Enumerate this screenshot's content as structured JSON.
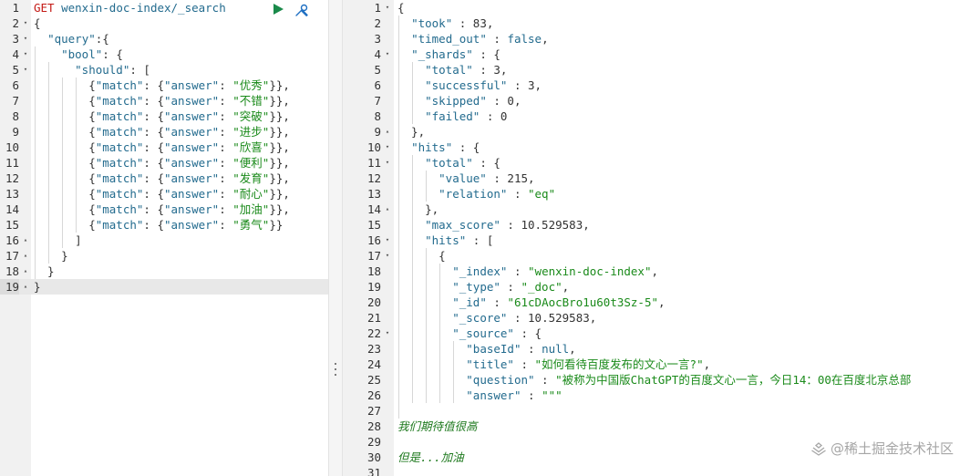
{
  "request_editor": {
    "lines": [
      {
        "n": "1",
        "fold": "",
        "tokens": [
          {
            "t": "GET",
            "c": "method"
          },
          {
            "t": " ",
            "c": "punc"
          },
          {
            "t": "wenxin-doc-index/_search",
            "c": "url"
          }
        ]
      },
      {
        "n": "2",
        "fold": "▾",
        "tokens": [
          {
            "t": "{",
            "c": "punc"
          }
        ]
      },
      {
        "n": "3",
        "fold": "▾",
        "tokens": [
          {
            "t": "  ",
            "c": "punc"
          },
          {
            "t": "\"query\"",
            "c": "key"
          },
          {
            "t": ":{",
            "c": "punc"
          }
        ]
      },
      {
        "n": "4",
        "fold": "▾",
        "tokens": [
          {
            "t": "    ",
            "c": "punc"
          },
          {
            "t": "\"bool\"",
            "c": "key"
          },
          {
            "t": ": {",
            "c": "punc"
          }
        ]
      },
      {
        "n": "5",
        "fold": "▾",
        "tokens": [
          {
            "t": "      ",
            "c": "punc"
          },
          {
            "t": "\"should\"",
            "c": "key"
          },
          {
            "t": ": [",
            "c": "punc"
          }
        ]
      },
      {
        "n": "6",
        "fold": "",
        "tokens": [
          {
            "t": "        {",
            "c": "punc"
          },
          {
            "t": "\"match\"",
            "c": "key"
          },
          {
            "t": ": {",
            "c": "punc"
          },
          {
            "t": "\"answer\"",
            "c": "key"
          },
          {
            "t": ": ",
            "c": "punc"
          },
          {
            "t": "\"优秀\"",
            "c": "str"
          },
          {
            "t": "}},",
            "c": "punc"
          }
        ]
      },
      {
        "n": "7",
        "fold": "",
        "tokens": [
          {
            "t": "        {",
            "c": "punc"
          },
          {
            "t": "\"match\"",
            "c": "key"
          },
          {
            "t": ": {",
            "c": "punc"
          },
          {
            "t": "\"answer\"",
            "c": "key"
          },
          {
            "t": ": ",
            "c": "punc"
          },
          {
            "t": "\"不错\"",
            "c": "str"
          },
          {
            "t": "}},",
            "c": "punc"
          }
        ]
      },
      {
        "n": "8",
        "fold": "",
        "tokens": [
          {
            "t": "        {",
            "c": "punc"
          },
          {
            "t": "\"match\"",
            "c": "key"
          },
          {
            "t": ": {",
            "c": "punc"
          },
          {
            "t": "\"answer\"",
            "c": "key"
          },
          {
            "t": ": ",
            "c": "punc"
          },
          {
            "t": "\"突破\"",
            "c": "str"
          },
          {
            "t": "}},",
            "c": "punc"
          }
        ]
      },
      {
        "n": "9",
        "fold": "",
        "tokens": [
          {
            "t": "        {",
            "c": "punc"
          },
          {
            "t": "\"match\"",
            "c": "key"
          },
          {
            "t": ": {",
            "c": "punc"
          },
          {
            "t": "\"answer\"",
            "c": "key"
          },
          {
            "t": ": ",
            "c": "punc"
          },
          {
            "t": "\"进步\"",
            "c": "str"
          },
          {
            "t": "}},",
            "c": "punc"
          }
        ]
      },
      {
        "n": "10",
        "fold": "",
        "tokens": [
          {
            "t": "        {",
            "c": "punc"
          },
          {
            "t": "\"match\"",
            "c": "key"
          },
          {
            "t": ": {",
            "c": "punc"
          },
          {
            "t": "\"answer\"",
            "c": "key"
          },
          {
            "t": ": ",
            "c": "punc"
          },
          {
            "t": "\"欣喜\"",
            "c": "str"
          },
          {
            "t": "}},",
            "c": "punc"
          }
        ]
      },
      {
        "n": "11",
        "fold": "",
        "tokens": [
          {
            "t": "        {",
            "c": "punc"
          },
          {
            "t": "\"match\"",
            "c": "key"
          },
          {
            "t": ": {",
            "c": "punc"
          },
          {
            "t": "\"answer\"",
            "c": "key"
          },
          {
            "t": ": ",
            "c": "punc"
          },
          {
            "t": "\"便利\"",
            "c": "str"
          },
          {
            "t": "}},",
            "c": "punc"
          }
        ]
      },
      {
        "n": "12",
        "fold": "",
        "tokens": [
          {
            "t": "        {",
            "c": "punc"
          },
          {
            "t": "\"match\"",
            "c": "key"
          },
          {
            "t": ": {",
            "c": "punc"
          },
          {
            "t": "\"answer\"",
            "c": "key"
          },
          {
            "t": ": ",
            "c": "punc"
          },
          {
            "t": "\"发育\"",
            "c": "str"
          },
          {
            "t": "}},",
            "c": "punc"
          }
        ]
      },
      {
        "n": "13",
        "fold": "",
        "tokens": [
          {
            "t": "        {",
            "c": "punc"
          },
          {
            "t": "\"match\"",
            "c": "key"
          },
          {
            "t": ": {",
            "c": "punc"
          },
          {
            "t": "\"answer\"",
            "c": "key"
          },
          {
            "t": ": ",
            "c": "punc"
          },
          {
            "t": "\"耐心\"",
            "c": "str"
          },
          {
            "t": "}},",
            "c": "punc"
          }
        ]
      },
      {
        "n": "14",
        "fold": "",
        "tokens": [
          {
            "t": "        {",
            "c": "punc"
          },
          {
            "t": "\"match\"",
            "c": "key"
          },
          {
            "t": ": {",
            "c": "punc"
          },
          {
            "t": "\"answer\"",
            "c": "key"
          },
          {
            "t": ": ",
            "c": "punc"
          },
          {
            "t": "\"加油\"",
            "c": "str"
          },
          {
            "t": "}},",
            "c": "punc"
          }
        ]
      },
      {
        "n": "15",
        "fold": "",
        "tokens": [
          {
            "t": "        {",
            "c": "punc"
          },
          {
            "t": "\"match\"",
            "c": "key"
          },
          {
            "t": ": {",
            "c": "punc"
          },
          {
            "t": "\"answer\"",
            "c": "key"
          },
          {
            "t": ": ",
            "c": "punc"
          },
          {
            "t": "\"勇气\"",
            "c": "str"
          },
          {
            "t": "}}",
            "c": "punc"
          }
        ]
      },
      {
        "n": "16",
        "fold": "▴",
        "tokens": [
          {
            "t": "      ]",
            "c": "punc"
          }
        ]
      },
      {
        "n": "17",
        "fold": "▴",
        "tokens": [
          {
            "t": "    }",
            "c": "punc"
          }
        ]
      },
      {
        "n": "18",
        "fold": "▴",
        "tokens": [
          {
            "t": "  }",
            "c": "punc"
          }
        ]
      },
      {
        "n": "19",
        "fold": "▴",
        "tokens": [
          {
            "t": "}",
            "c": "punc"
          }
        ],
        "active": true
      }
    ]
  },
  "response_viewer": {
    "lines": [
      {
        "n": "1",
        "fold": "▾",
        "tokens": [
          {
            "t": "{",
            "c": "punc"
          }
        ]
      },
      {
        "n": "2",
        "fold": "",
        "tokens": [
          {
            "t": "  ",
            "c": "punc"
          },
          {
            "t": "\"took\"",
            "c": "key"
          },
          {
            "t": " : ",
            "c": "punc"
          },
          {
            "t": "83",
            "c": "num"
          },
          {
            "t": ",",
            "c": "punc"
          }
        ]
      },
      {
        "n": "3",
        "fold": "",
        "tokens": [
          {
            "t": "  ",
            "c": "punc"
          },
          {
            "t": "\"timed_out\"",
            "c": "key"
          },
          {
            "t": " : ",
            "c": "punc"
          },
          {
            "t": "false",
            "c": "lit"
          },
          {
            "t": ",",
            "c": "punc"
          }
        ]
      },
      {
        "n": "4",
        "fold": "▾",
        "tokens": [
          {
            "t": "  ",
            "c": "punc"
          },
          {
            "t": "\"_shards\"",
            "c": "key"
          },
          {
            "t": " : {",
            "c": "punc"
          }
        ]
      },
      {
        "n": "5",
        "fold": "",
        "tokens": [
          {
            "t": "    ",
            "c": "punc"
          },
          {
            "t": "\"total\"",
            "c": "key"
          },
          {
            "t": " : ",
            "c": "punc"
          },
          {
            "t": "3",
            "c": "num"
          },
          {
            "t": ",",
            "c": "punc"
          }
        ]
      },
      {
        "n": "6",
        "fold": "",
        "tokens": [
          {
            "t": "    ",
            "c": "punc"
          },
          {
            "t": "\"successful\"",
            "c": "key"
          },
          {
            "t": " : ",
            "c": "punc"
          },
          {
            "t": "3",
            "c": "num"
          },
          {
            "t": ",",
            "c": "punc"
          }
        ]
      },
      {
        "n": "7",
        "fold": "",
        "tokens": [
          {
            "t": "    ",
            "c": "punc"
          },
          {
            "t": "\"skipped\"",
            "c": "key"
          },
          {
            "t": " : ",
            "c": "punc"
          },
          {
            "t": "0",
            "c": "num"
          },
          {
            "t": ",",
            "c": "punc"
          }
        ]
      },
      {
        "n": "8",
        "fold": "",
        "tokens": [
          {
            "t": "    ",
            "c": "punc"
          },
          {
            "t": "\"failed\"",
            "c": "key"
          },
          {
            "t": " : ",
            "c": "punc"
          },
          {
            "t": "0",
            "c": "num"
          }
        ]
      },
      {
        "n": "9",
        "fold": "▴",
        "tokens": [
          {
            "t": "  },",
            "c": "punc"
          }
        ]
      },
      {
        "n": "10",
        "fold": "▾",
        "tokens": [
          {
            "t": "  ",
            "c": "punc"
          },
          {
            "t": "\"hits\"",
            "c": "key"
          },
          {
            "t": " : {",
            "c": "punc"
          }
        ]
      },
      {
        "n": "11",
        "fold": "▾",
        "tokens": [
          {
            "t": "    ",
            "c": "punc"
          },
          {
            "t": "\"total\"",
            "c": "key"
          },
          {
            "t": " : {",
            "c": "punc"
          }
        ]
      },
      {
        "n": "12",
        "fold": "",
        "tokens": [
          {
            "t": "      ",
            "c": "punc"
          },
          {
            "t": "\"value\"",
            "c": "key"
          },
          {
            "t": " : ",
            "c": "punc"
          },
          {
            "t": "215",
            "c": "num"
          },
          {
            "t": ",",
            "c": "punc"
          }
        ]
      },
      {
        "n": "13",
        "fold": "",
        "tokens": [
          {
            "t": "      ",
            "c": "punc"
          },
          {
            "t": "\"relation\"",
            "c": "key"
          },
          {
            "t": " : ",
            "c": "punc"
          },
          {
            "t": "\"eq\"",
            "c": "str"
          }
        ]
      },
      {
        "n": "14",
        "fold": "▴",
        "tokens": [
          {
            "t": "    },",
            "c": "punc"
          }
        ]
      },
      {
        "n": "15",
        "fold": "",
        "tokens": [
          {
            "t": "    ",
            "c": "punc"
          },
          {
            "t": "\"max_score\"",
            "c": "key"
          },
          {
            "t": " : ",
            "c": "punc"
          },
          {
            "t": "10.529583",
            "c": "num"
          },
          {
            "t": ",",
            "c": "punc"
          }
        ]
      },
      {
        "n": "16",
        "fold": "▾",
        "tokens": [
          {
            "t": "    ",
            "c": "punc"
          },
          {
            "t": "\"hits\"",
            "c": "key"
          },
          {
            "t": " : [",
            "c": "punc"
          }
        ]
      },
      {
        "n": "17",
        "fold": "▾",
        "tokens": [
          {
            "t": "      {",
            "c": "punc"
          }
        ]
      },
      {
        "n": "18",
        "fold": "",
        "tokens": [
          {
            "t": "        ",
            "c": "punc"
          },
          {
            "t": "\"_index\"",
            "c": "key"
          },
          {
            "t": " : ",
            "c": "punc"
          },
          {
            "t": "\"wenxin-doc-index\"",
            "c": "str"
          },
          {
            "t": ",",
            "c": "punc"
          }
        ]
      },
      {
        "n": "19",
        "fold": "",
        "tokens": [
          {
            "t": "        ",
            "c": "punc"
          },
          {
            "t": "\"_type\"",
            "c": "key"
          },
          {
            "t": " : ",
            "c": "punc"
          },
          {
            "t": "\"_doc\"",
            "c": "str"
          },
          {
            "t": ",",
            "c": "punc"
          }
        ]
      },
      {
        "n": "20",
        "fold": "",
        "tokens": [
          {
            "t": "        ",
            "c": "punc"
          },
          {
            "t": "\"_id\"",
            "c": "key"
          },
          {
            "t": " : ",
            "c": "punc"
          },
          {
            "t": "\"61cDAocBro1u60t3Sz-5\"",
            "c": "str"
          },
          {
            "t": ",",
            "c": "punc"
          }
        ]
      },
      {
        "n": "21",
        "fold": "",
        "tokens": [
          {
            "t": "        ",
            "c": "punc"
          },
          {
            "t": "\"_score\"",
            "c": "key"
          },
          {
            "t": " : ",
            "c": "punc"
          },
          {
            "t": "10.529583",
            "c": "num"
          },
          {
            "t": ",",
            "c": "punc"
          }
        ]
      },
      {
        "n": "22",
        "fold": "▾",
        "tokens": [
          {
            "t": "        ",
            "c": "punc"
          },
          {
            "t": "\"_source\"",
            "c": "key"
          },
          {
            "t": " : {",
            "c": "punc"
          }
        ]
      },
      {
        "n": "23",
        "fold": "",
        "tokens": [
          {
            "t": "          ",
            "c": "punc"
          },
          {
            "t": "\"baseId\"",
            "c": "key"
          },
          {
            "t": " : ",
            "c": "punc"
          },
          {
            "t": "null",
            "c": "lit"
          },
          {
            "t": ",",
            "c": "punc"
          }
        ]
      },
      {
        "n": "24",
        "fold": "",
        "tokens": [
          {
            "t": "          ",
            "c": "punc"
          },
          {
            "t": "\"title\"",
            "c": "key"
          },
          {
            "t": " : ",
            "c": "punc"
          },
          {
            "t": "\"如何看待百度发布的文心一言?\"",
            "c": "str"
          },
          {
            "t": ",",
            "c": "punc"
          }
        ]
      },
      {
        "n": "25",
        "fold": "",
        "tokens": [
          {
            "t": "          ",
            "c": "punc"
          },
          {
            "t": "\"question\"",
            "c": "key"
          },
          {
            "t": " : ",
            "c": "punc"
          },
          {
            "t": "\"被称为中国版ChatGPT的百度文心一言，今日14：00在百度北京总部",
            "c": "str"
          }
        ]
      },
      {
        "n": "26",
        "fold": "",
        "tokens": [
          {
            "t": "          ",
            "c": "punc"
          },
          {
            "t": "\"answer\"",
            "c": "key"
          },
          {
            "t": " : ",
            "c": "punc"
          },
          {
            "t": "\"\"\"",
            "c": "str"
          }
        ]
      },
      {
        "n": "27",
        "fold": "",
        "tokens": []
      },
      {
        "n": "28",
        "fold": "",
        "tokens": [
          {
            "t": "我们期待值很高",
            "c": "comment"
          }
        ]
      },
      {
        "n": "29",
        "fold": "",
        "tokens": []
      },
      {
        "n": "30",
        "fold": "",
        "tokens": [
          {
            "t": "但是...加油",
            "c": "comment"
          }
        ]
      },
      {
        "n": "31",
        "fold": "",
        "tokens": []
      }
    ]
  },
  "toolbar": {
    "run_icon": "play-icon",
    "settings_icon": "wrench-icon"
  },
  "watermark": {
    "text": "@稀土掘金技术社区"
  },
  "colors": {
    "key": "#236b8e",
    "string": "#1a8a1a",
    "method": "#c41a16",
    "run": "#1a8a4a",
    "settings": "#1e6fc2"
  }
}
